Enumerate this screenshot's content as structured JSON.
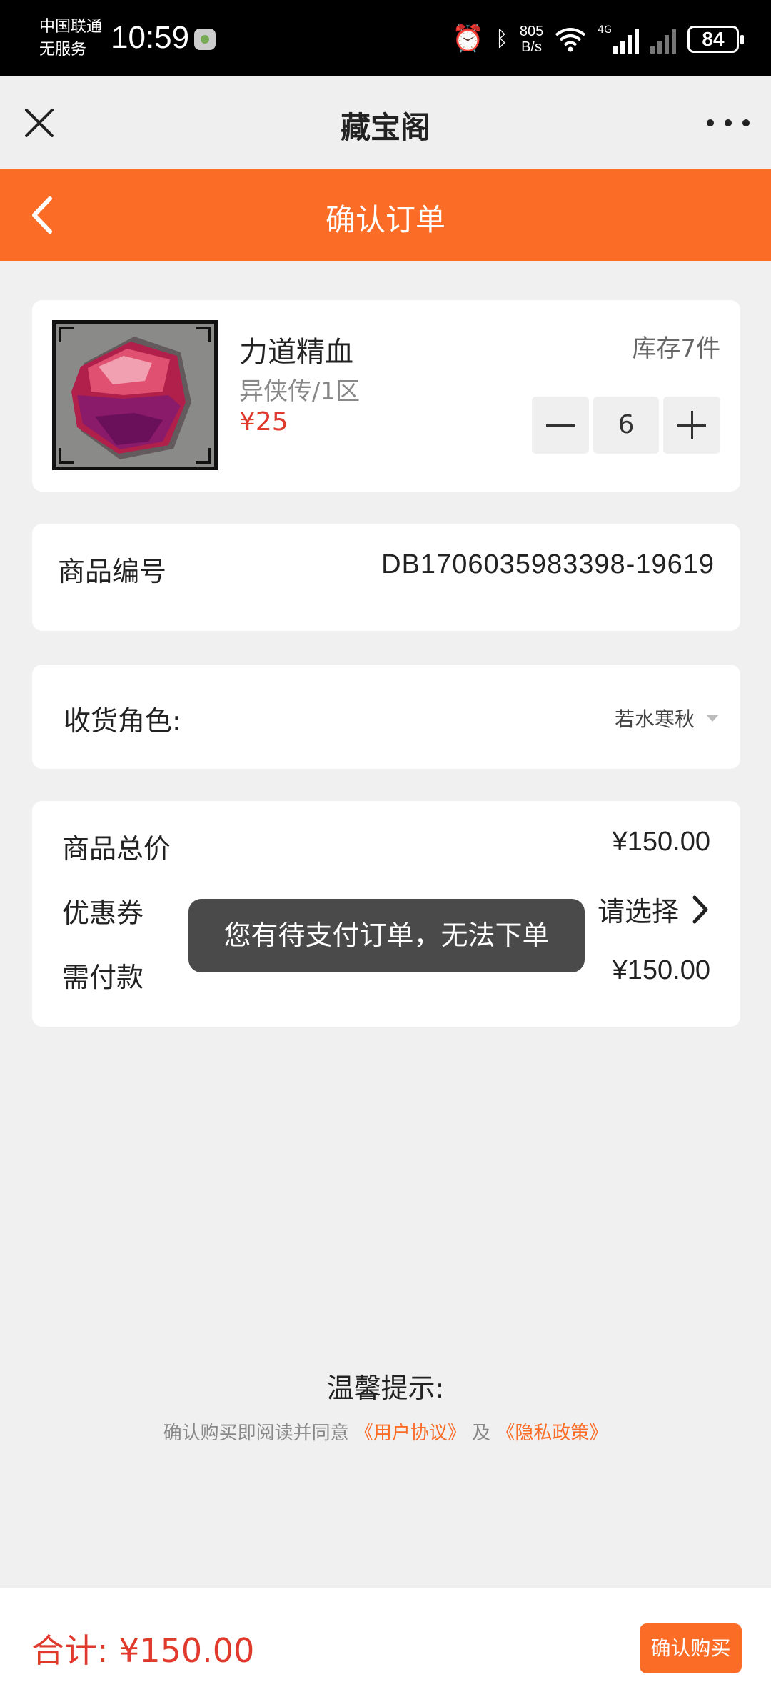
{
  "status_bar": {
    "carrier_line1": "中国联通",
    "carrier_line2": "无服务",
    "time": "10:59",
    "net_speed_value": "805",
    "net_speed_unit": "B/s",
    "network_type": "4G",
    "battery": "84"
  },
  "title_bar": {
    "title": "藏宝阁"
  },
  "header": {
    "title": "确认订单"
  },
  "product": {
    "name": "力道精血",
    "server": "异侠传/1区",
    "price": "¥25",
    "stock": "库存7件",
    "quantity": "6"
  },
  "item_code": {
    "label": "商品编号",
    "value": "DB1706035983398-19619"
  },
  "role": {
    "label": "收货角色:",
    "value": "若水寒秋"
  },
  "summary": {
    "total_label": "商品总价",
    "total_value": "¥150.00",
    "coupon_label": "优惠券",
    "coupon_value": "请选择",
    "payable_label": "需付款",
    "payable_value": "¥150.00"
  },
  "toast": {
    "message": "您有待支付订单，无法下单"
  },
  "tips": {
    "title": "温馨提示:",
    "prefix": "确认购买即阅读并同意",
    "user_agreement": "《用户协议》",
    "and": "及",
    "privacy_policy": "《隐私政策》"
  },
  "bottom_bar": {
    "total_text": "合计: ¥150.00",
    "confirm_label": "确认购买"
  },
  "colors": {
    "accent": "#fb6c26",
    "price_red": "#e03a2c",
    "toast_bg": "#4a4a4a"
  }
}
